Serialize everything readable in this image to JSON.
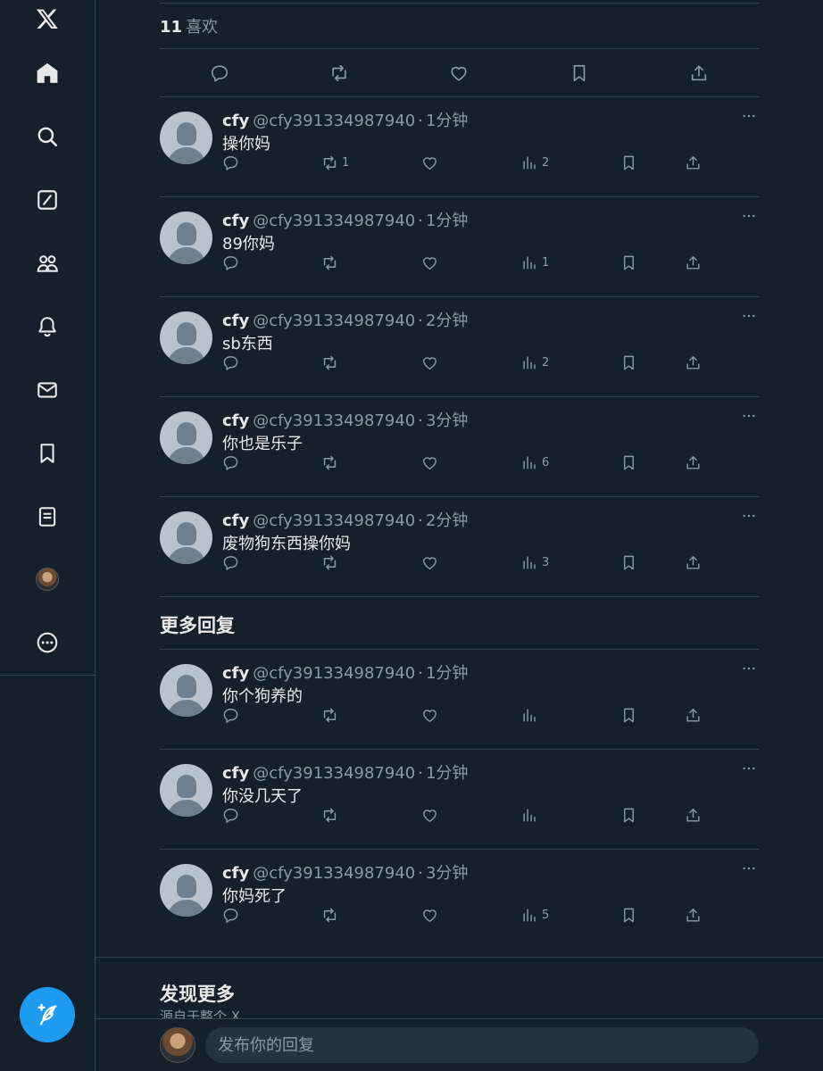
{
  "post": {
    "likes_count": "11",
    "likes_label": "喜欢"
  },
  "replies": [
    {
      "name": "cfy",
      "handle": "@cfy391334987940",
      "dot": "·",
      "time": "1分钟",
      "text": "操你妈",
      "retweets": "1",
      "views": "2"
    },
    {
      "name": "cfy",
      "handle": "@cfy391334987940",
      "dot": "·",
      "time": "1分钟",
      "text": "89你妈",
      "retweets": "",
      "views": "1"
    },
    {
      "name": "cfy",
      "handle": "@cfy391334987940",
      "dot": "·",
      "time": "2分钟",
      "text": "sb东西",
      "retweets": "",
      "views": "2"
    },
    {
      "name": "cfy",
      "handle": "@cfy391334987940",
      "dot": "·",
      "time": "3分钟",
      "text": "你也是乐子",
      "retweets": "",
      "views": "6"
    },
    {
      "name": "cfy",
      "handle": "@cfy391334987940",
      "dot": "·",
      "time": "2分钟",
      "text": "废物狗东西操你妈",
      "retweets": "",
      "views": "3"
    }
  ],
  "more_replies_title": "更多回复",
  "more_replies": [
    {
      "name": "cfy",
      "handle": "@cfy391334987940",
      "dot": "·",
      "time": "1分钟",
      "text": "你个狗养的",
      "retweets": "",
      "views": ""
    },
    {
      "name": "cfy",
      "handle": "@cfy391334987940",
      "dot": "·",
      "time": "1分钟",
      "text": "你没几天了",
      "retweets": "",
      "views": ""
    },
    {
      "name": "cfy",
      "handle": "@cfy391334987940",
      "dot": "·",
      "time": "3分钟",
      "text": "你妈死了",
      "retweets": "",
      "views": "5"
    }
  ],
  "discover": {
    "title": "发现更多",
    "subtitle": "源自于整个 X"
  },
  "reply_bar": {
    "placeholder": "发布你的回复"
  },
  "sidebar": {
    "items": [
      "x-logo",
      "home-icon",
      "search-icon",
      "grok-icon",
      "communities-icon",
      "notifications-icon",
      "messages-icon",
      "bookmarks-icon",
      "lists-icon",
      "profile-avatar",
      "more-icon"
    ]
  },
  "colors": {
    "background": "#15202b",
    "border": "#38444d",
    "text": "#e7e9ea",
    "muted": "#8b98a5",
    "accent": "#1d9bf0"
  }
}
